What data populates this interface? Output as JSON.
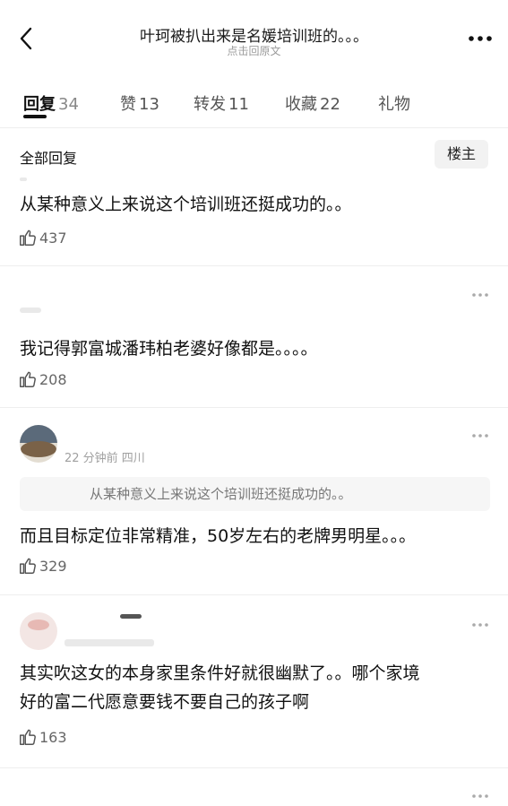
{
  "header": {
    "title": "叶珂被扒出来是名媛培训班的。。。",
    "subtitle": "点击回原文"
  },
  "tabs": [
    {
      "label": "回复",
      "count": "34"
    },
    {
      "label": "赞",
      "count": "13"
    },
    {
      "label": "转发",
      "count": "11"
    },
    {
      "label": "收藏",
      "count": "22"
    },
    {
      "label": "礼物",
      "count": ""
    }
  ],
  "filter": {
    "label": "全部回复",
    "op_button": "楼主"
  },
  "comments": [
    {
      "text": "从某种意义上来说这个培训班还挺成功的。。",
      "likes": "437"
    },
    {
      "text": "我记得郭富城潘玮柏老婆好像都是。。。。",
      "likes": "208"
    },
    {
      "meta": "22 分钟前  四川",
      "quote": "从某种意义上来说这个培训班还挺成功的。。",
      "text": "而且目标定位非常精准，50岁左右的老牌男明星。。。",
      "likes": "329"
    },
    {
      "text_line1": "其实吹这女的本身家里条件好就很幽默了。。哪个家境",
      "text_line2": "好的富二代愿意要钱不要自己的孩子啊",
      "likes": "163"
    }
  ],
  "colors": {
    "text": "#111111",
    "muted": "#9a9a9a",
    "divider": "#eeeeee",
    "quote_bg": "#f6f6f6"
  },
  "icons": [
    "back-arrow-icon",
    "more-dots-icon",
    "thumbs-up-icon"
  ]
}
